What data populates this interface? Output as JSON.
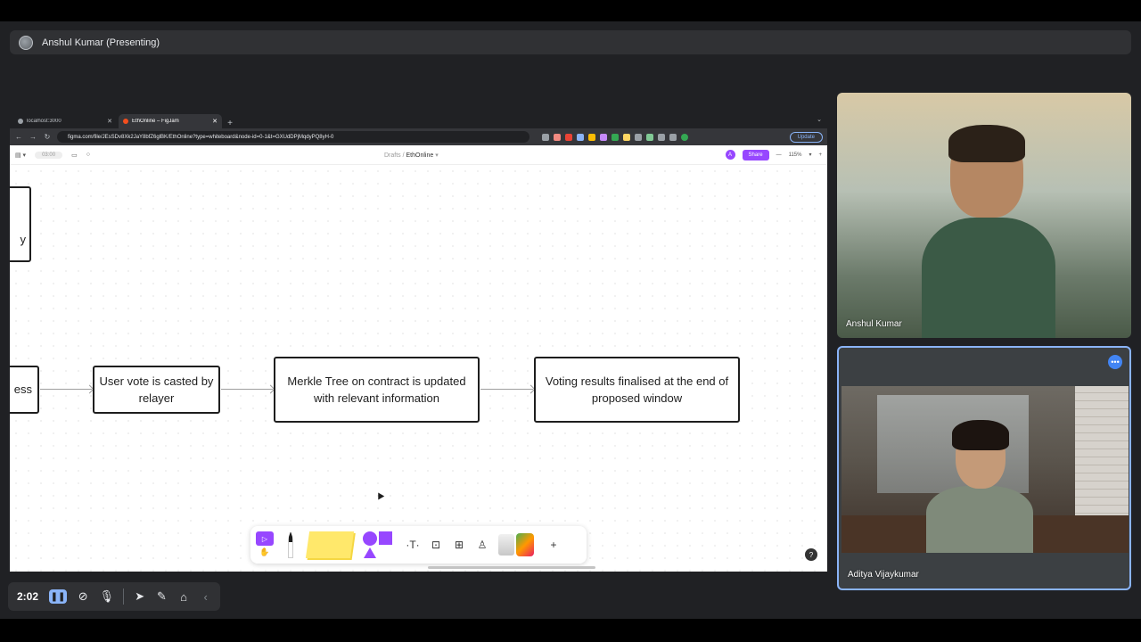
{
  "presenter": {
    "title": "Anshul Kumar (Presenting)"
  },
  "browser": {
    "tabs": [
      {
        "label": "localhost:3000"
      },
      {
        "label": "EthOnline – FigJam"
      }
    ],
    "url": "figma.com/file/JEsSDv8Xk2JaY8bfZ6glBK/EthOnline?type=whiteboard&node-id=0-1&t=GXUdDPjMqdyPQ8yH-0",
    "update_label": "Update"
  },
  "figjam": {
    "breadcrumb_root": "Drafts",
    "file_name": "EthOnline",
    "avatar_letter": "A",
    "share_label": "Share",
    "zoom": "115%",
    "timer": "03:00"
  },
  "flow": {
    "partial_left_top": "y",
    "partial_left_bottom": "ess",
    "nodes": [
      {
        "text": "User vote is casted by relayer"
      },
      {
        "text": "Merkle Tree on contract is updated with relevant information"
      },
      {
        "text": "Voting results finalised at the end of proposed window"
      }
    ]
  },
  "participants": [
    {
      "name": "Anshul Kumar"
    },
    {
      "name": "Aditya Vijaykumar"
    }
  ],
  "controls": {
    "time": "2:02"
  },
  "colors": {
    "accent": "#8ab4f8",
    "figjam_purple": "#9747ff",
    "sticky": "#ffe86b"
  }
}
